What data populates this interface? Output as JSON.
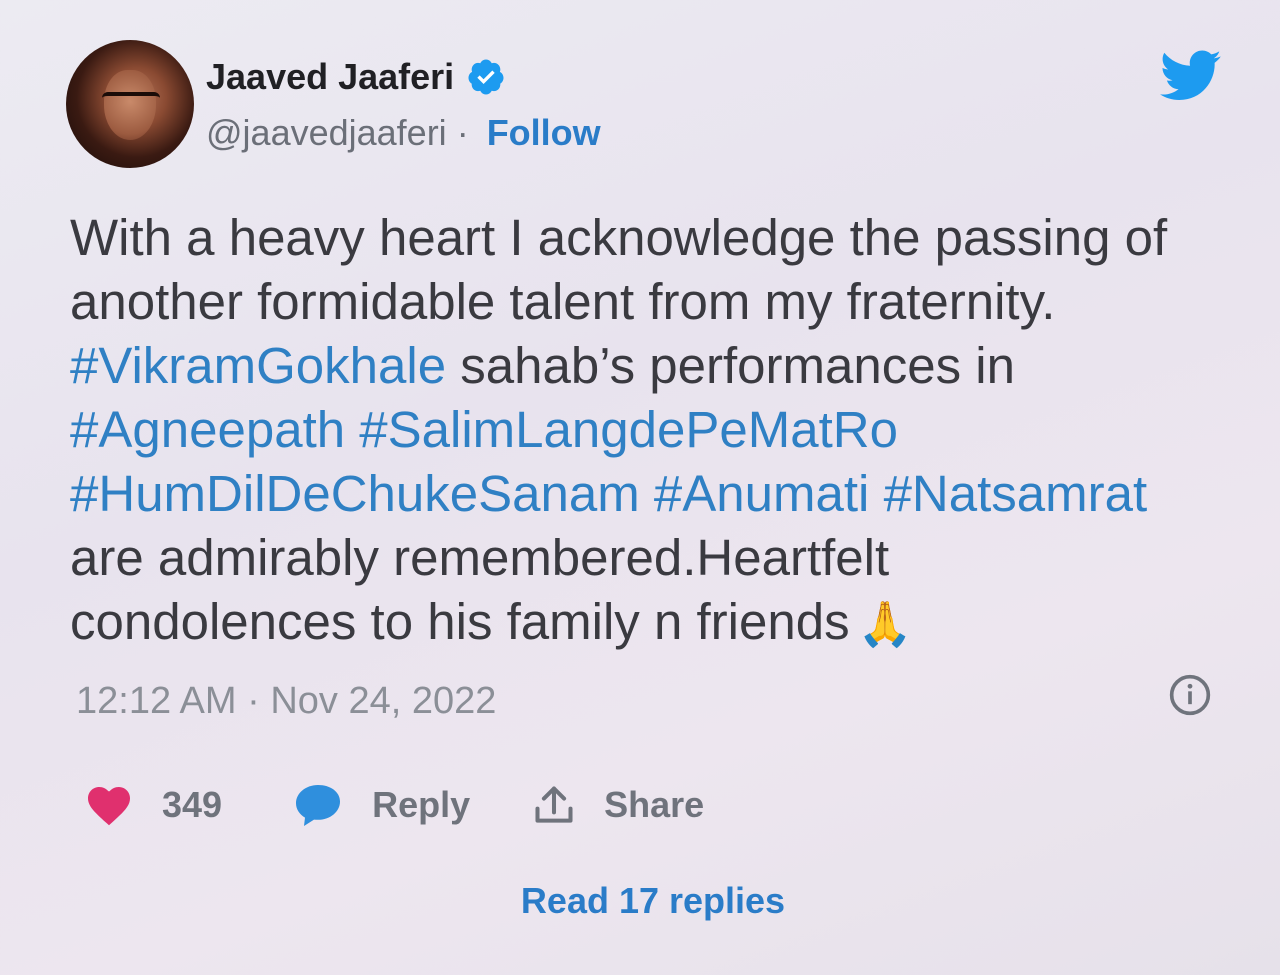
{
  "author": {
    "name": "Jaaved Jaaferi",
    "handle": "@jaavedjaaferi",
    "separator": " · ",
    "follow_label": "Follow"
  },
  "tweet": {
    "lines": [
      [
        {
          "text": "With a heavy heart I acknowledge the passing of",
          "type": "text"
        }
      ],
      [
        {
          "text": "another formidable talent from my fraternity.",
          "type": "text"
        }
      ],
      [
        {
          "text": "#VikramGokhale",
          "type": "hashtag"
        },
        {
          "text": " sahab’s performances in",
          "type": "text"
        }
      ],
      [
        {
          "text": "#Agneepath",
          "type": "hashtag"
        },
        {
          "text": " ",
          "type": "text"
        },
        {
          "text": "#SalimLangdePeMatRo",
          "type": "hashtag"
        }
      ],
      [
        {
          "text": "#HumDilDeChukeSanam",
          "type": "hashtag"
        },
        {
          "text": " ",
          "type": "text"
        },
        {
          "text": "#Anumati",
          "type": "hashtag"
        },
        {
          "text": " ",
          "type": "text"
        },
        {
          "text": "#Natsamrat",
          "type": "hashtag"
        }
      ],
      [
        {
          "text": "are admirably remembered.Heartfelt",
          "type": "text"
        }
      ],
      [
        {
          "text": "condolences to his family n friends",
          "type": "text"
        },
        {
          "text": "🙏",
          "type": "emoji"
        }
      ]
    ],
    "timestamp": "12:12 AM · Nov 24, 2022"
  },
  "actions": {
    "like_count": "349",
    "reply_label": "Reply",
    "share_label": "Share"
  },
  "read_replies_label": "Read 17 replies",
  "icons": {
    "twitter": "twitter-bird-icon",
    "verified": "verified-badge-icon",
    "info": "info-icon",
    "like": "heart-icon",
    "reply": "speech-bubble-icon",
    "share": "share-upload-icon"
  },
  "colors": {
    "link": "#2a7cc8",
    "hashtag": "#2f80c4",
    "heart": "#e0306e",
    "reply": "#2f8fdd",
    "twitter": "#1d9bf0"
  }
}
